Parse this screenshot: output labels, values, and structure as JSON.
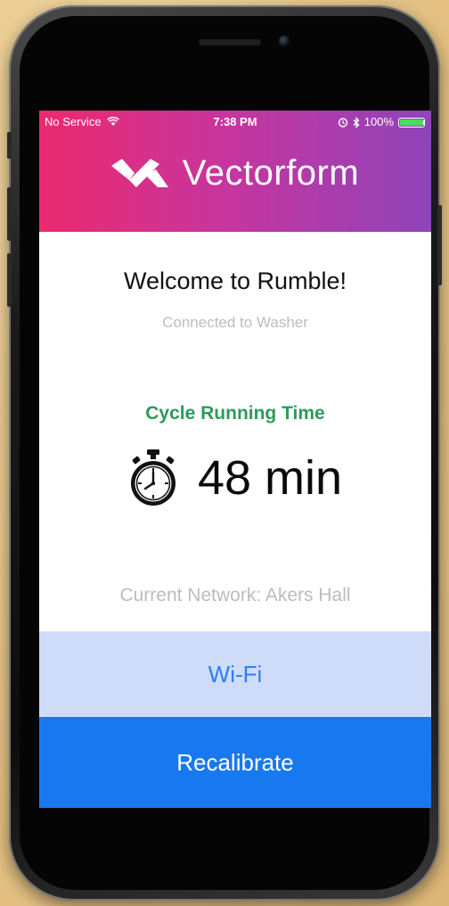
{
  "status_bar": {
    "carrier": "No Service",
    "time": "7:38 PM",
    "battery": "100%",
    "battery_level": 1.0,
    "icons": [
      "wifi-icon",
      "alarm-icon",
      "bluetooth-icon",
      "battery-icon"
    ]
  },
  "header": {
    "brand": "Vectorform",
    "logo_icon": "vectorform-logo-icon",
    "gradient": [
      "#ec2a6f",
      "#8e44b9"
    ]
  },
  "main": {
    "welcome": "Welcome to Rumble!",
    "connection_status": "Connected to Washer",
    "cycle_label": "Cycle Running Time",
    "cycle_time": "48 min",
    "timer_icon": "stopwatch-icon",
    "network": "Current Network: Akers Hall"
  },
  "actions": {
    "wifi_label": "Wi-Fi",
    "recalibrate_label": "Recalibrate"
  },
  "colors": {
    "accent_green": "#2e9a5a",
    "wifi_bg": "#cedcf9",
    "wifi_text": "#2f7df3",
    "primary_blue": "#1878ef"
  }
}
